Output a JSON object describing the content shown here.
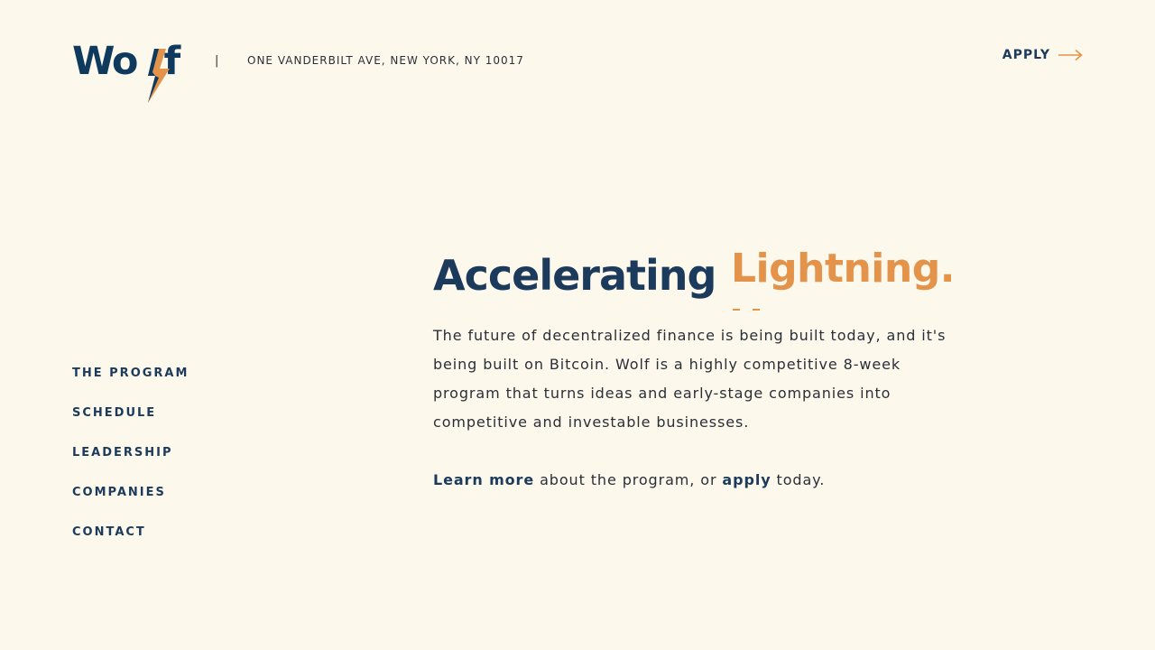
{
  "brand": {
    "logo_text": "Wolf",
    "logo_icon": "lightning-bolt-icon",
    "colors": {
      "background": "#fcf8ec",
      "navy": "#1b3a5c",
      "orange": "#e3934a",
      "text": "#2a2f38"
    }
  },
  "header": {
    "separator": "|",
    "address": "ONE VANDERBILT AVE, NEW YORK, NY 10017",
    "apply_label": "APPLY",
    "apply_icon": "arrow-right-icon"
  },
  "nav": {
    "items": [
      {
        "label": "THE PROGRAM"
      },
      {
        "label": "SCHEDULE"
      },
      {
        "label": "LEADERSHIP"
      },
      {
        "label": "COMPANIES"
      },
      {
        "label": "CONTACT"
      }
    ]
  },
  "hero": {
    "headline_main": "Accelerating",
    "headline_accent": "Lightning.",
    "intro": "The future of decentralized finance is being built today, and it's being built on Bitcoin. Wolf is a highly competitive 8-week program that turns ideas and early-stage companies into competitive and investable businesses.",
    "cta_link_1": "Learn more",
    "cta_text_1": " about the program, or ",
    "cta_link_2": "apply",
    "cta_text_2": " today."
  }
}
